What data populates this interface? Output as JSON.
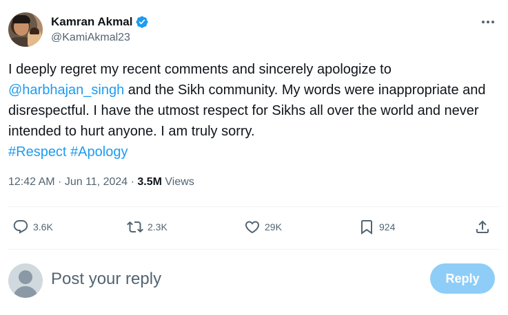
{
  "author": {
    "display_name": "Kamran Akmal",
    "handle": "@KamiAkmal23",
    "verified": true
  },
  "tweet": {
    "text_part1": "I deeply regret my recent comments and sincerely apologize to",
    "mention": "@harbhajan_singh",
    "text_part2": " and the Sikh community. My words were inappropriate and disrespectful. I have the utmost respect for Sikhs all over the world and never intended to hurt anyone. I am truly sorry.",
    "hashtag1": "#Respect",
    "hashtag2": "#Apology"
  },
  "meta": {
    "time": "12:42 AM",
    "separator": " · ",
    "date": "Jun 11, 2024",
    "views_count": "3.5M",
    "views_label": "Views"
  },
  "actions": {
    "replies": "3.6K",
    "reposts": "2.3K",
    "likes": "29K",
    "bookmarks": "924"
  },
  "reply": {
    "placeholder": "Post your reply",
    "button_label": "Reply"
  },
  "colors": {
    "accent": "#1d9bf0",
    "muted": "#536471",
    "reply_button_disabled": "#8ecdf8"
  },
  "icons": [
    "verified-badge-icon",
    "more-icon",
    "reply-icon",
    "repost-icon",
    "like-icon",
    "bookmark-icon",
    "share-icon"
  ]
}
